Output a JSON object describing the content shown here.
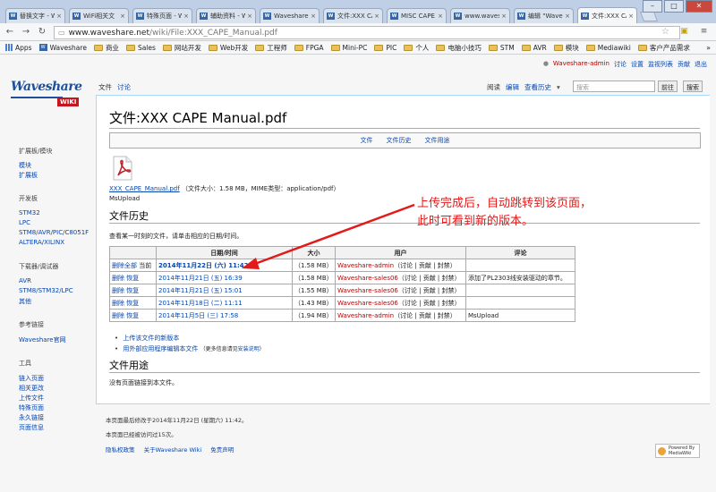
{
  "browser": {
    "tabs": [
      {
        "title": "替换文字 - W"
      },
      {
        "title": "WiFi相关文"
      },
      {
        "title": "特殊页面 - W"
      },
      {
        "title": "辅助资料 - W"
      },
      {
        "title": "Waveshare"
      },
      {
        "title": "文件:XXX CA"
      },
      {
        "title": "MISC CAPE"
      },
      {
        "title": "www.wavesh"
      },
      {
        "title": "编辑 \"Wave"
      },
      {
        "title": "文件:XXX CA"
      }
    ],
    "tab_fav": "W",
    "tab_close": "×",
    "window_min": "–",
    "window_max": "□",
    "window_close": "✕",
    "url_host": "www.waveshare.net",
    "url_path": "/wiki/File:XXX_CAPE_Manual.pdf",
    "bookmarks": [
      "Apps",
      "Waveshare",
      "商业",
      "Sales",
      "网站开发",
      "Web开发",
      "工程师",
      "FPGA",
      "Mini-PC",
      "PIC",
      "个人",
      "电脑小技巧",
      "STM",
      "AVR",
      "模块",
      "Mediawiki",
      "客户产品需求"
    ],
    "bookmarks_more": "»"
  },
  "wiki": {
    "personal": {
      "user": "Waveshare-admin",
      "talk": "讨论",
      "prefs": "设置",
      "watchlist": "监视列表",
      "contribs": "贡献",
      "logout": "退出"
    },
    "logo": {
      "name": "Waveshare",
      "badge": "WIKI"
    },
    "tabs_left": [
      "文件",
      "讨论"
    ],
    "tabs_right": [
      "阅读",
      "编辑",
      "查看历史"
    ],
    "more_arrow": "▾",
    "search_placeholder": "搜索",
    "go_button": "前往",
    "search_button": "搜索",
    "sidebar": {
      "section1": "扩展板/模块",
      "s1_links": [
        "模块",
        "扩展板"
      ],
      "section2": "开发板",
      "s2_links": [
        "STM32",
        "LPC",
        "STM8/AVR/PIC/C8051F",
        "ALTERA/XILINX"
      ],
      "section3": "下载器/调试器",
      "s3_links": [
        "AVR",
        "STM8/STM32/LPC",
        "其他"
      ],
      "section4": "参考链接",
      "s4_links": [
        "Waveshare官网"
      ],
      "section5": "工具",
      "s5_links": [
        "链入页面",
        "相关更改",
        "上传文件",
        "特殊页面",
        "永久链接",
        "页面信息"
      ]
    },
    "page_title": "文件:XXX CAPE Manual.pdf",
    "file_toc": [
      "文件",
      "文件历史",
      "文件用途"
    ],
    "file_link": "XXX_CAPE_Manual.pdf",
    "file_meta": "（文件大小：1.58 MB，MIME类型：application/pdf）",
    "upload_comment": "MsUpload",
    "history_heading": "文件历史",
    "history_hint": "查看某一时刻的文件，请单击相应的日期/时间。",
    "history_columns": [
      "日期/时间",
      "大小",
      "用户",
      "评论"
    ],
    "history_rows": [
      {
        "action1": "删除全部",
        "action2": "当前",
        "date": "2014年11月22日 (六) 11:42",
        "size": "（1.58 MB）",
        "user": "Waveshare-admin",
        "links": "（讨论 | 贡献 | 封禁）",
        "comment": ""
      },
      {
        "action1": "删除",
        "action2": "恢复",
        "date": "2014年11月21日 (五) 16:39",
        "size": "（1.58 MB）",
        "user": "Waveshare-sales06",
        "links": "（讨论 | 贡献 | 封禁）",
        "comment": "添加了PL2303线安装驱动的章节。"
      },
      {
        "action1": "删除",
        "action2": "恢复",
        "date": "2014年11月21日 (五) 15:01",
        "size": "（1.55 MB）",
        "user": "Waveshare-sales06",
        "links": "（讨论 | 贡献 | 封禁）",
        "comment": ""
      },
      {
        "action1": "删除",
        "action2": "恢复",
        "date": "2014年11月18日 (二) 11:11",
        "size": "（1.43 MB）",
        "user": "Waveshare-sales06",
        "links": "（讨论 | 贡献 | 封禁）",
        "comment": ""
      },
      {
        "action1": "删除",
        "action2": "恢复",
        "date": "2014年11月5日 (三) 17:58",
        "size": "（1.94 MB）",
        "user": "Waveshare-admin",
        "links": "（讨论 | 贡献 | 封禁）",
        "comment": "MsUpload"
      }
    ],
    "upload_new": "上传该文件的新版本",
    "edit_external": "用外部应用程序编辑本文件",
    "edit_external_note": "（更多信息请见",
    "edit_external_link": "安装说明",
    "edit_external_tail": "）",
    "usage_heading": "文件用途",
    "usage_text": "没有页面链接到本文件。",
    "footer_modified": "本页面最后修改于2014年11月22日 (星期六) 11:42。",
    "footer_views": "本页面已经被访问过15次。",
    "footer_links": [
      "隐私权政策",
      "关于Waveshare Wiki",
      "免责声明"
    ],
    "powered_by": "Powered By MediaWiki"
  },
  "annotation": {
    "line1": "上传完成后，自动跳转到该页面，",
    "line2": "此时可看到新的版本。",
    "color": "#e21a1a"
  }
}
